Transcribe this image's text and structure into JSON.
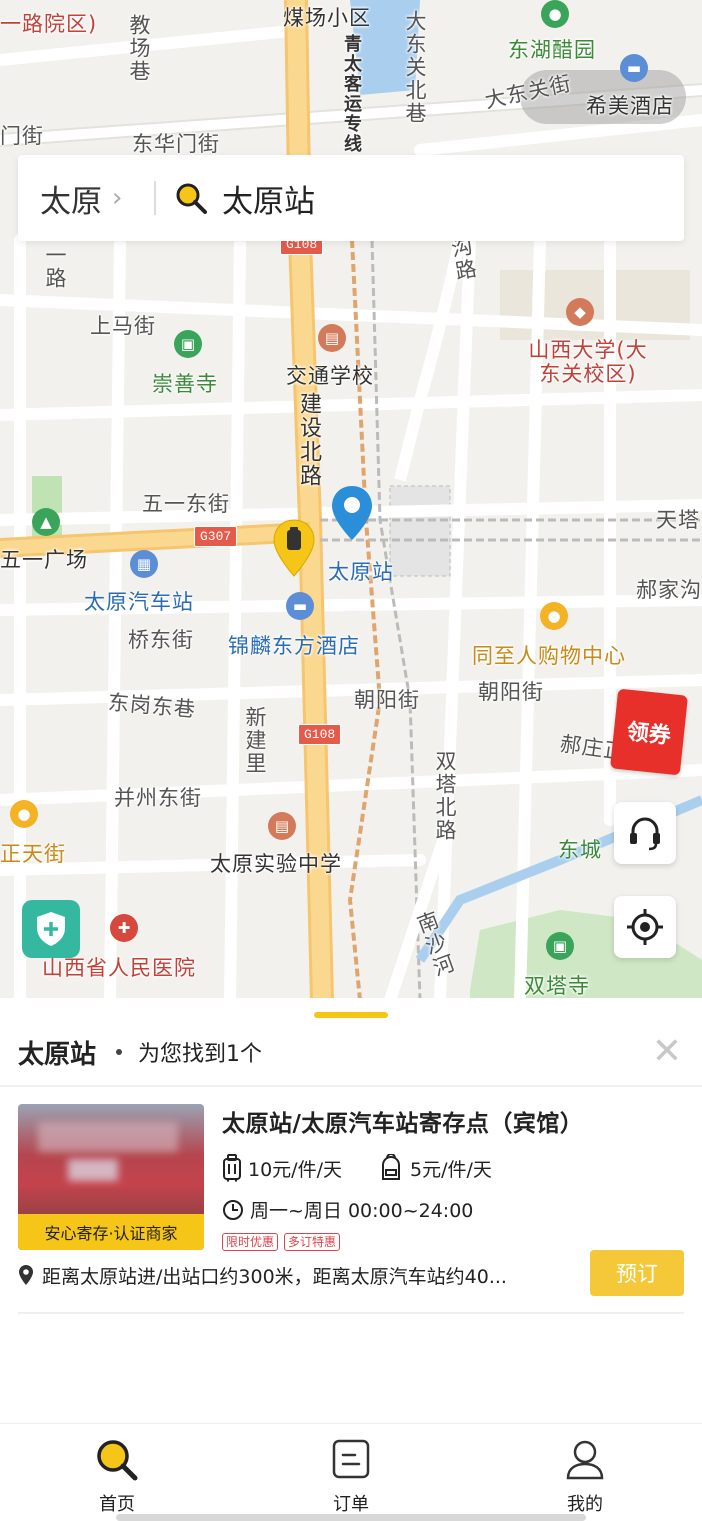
{
  "map": {
    "labels": {
      "meichang_xiaoqu": "煤场小区",
      "donghu_cuyuan": "东湖醋园",
      "dadongguan_jie": "大东关街",
      "ximei_jiudian": "希美酒店",
      "dongguan_beixiang": "大东关北巷",
      "jiaochang_xiang": "教场巷",
      "donghuamen_jie": "东华门街",
      "qingtai_keyun": "青太客运专线",
      "yilu_yuanqu": "一路院区)",
      "shangma_jie": "上马街",
      "chongshan_si": "崇善寺",
      "jiaotong_xuexiao": "交通学校",
      "shanxi_daxue": "山西大学(大东关校区)",
      "jianshe_beilu": "建设北路",
      "wuyi_dongjie": "五一东街",
      "wuyi_guangchang": "五一广场",
      "taiyuan_zhan": "太原站",
      "taiyuan_qichezhan": "太原汽车站",
      "tianta": "天塔",
      "qiaodong_jie": "桥东街",
      "jinlin_jiudian": "锦麟东方酒店",
      "tongzhiren": "同至人购物中心",
      "haojiagou": "郝家沟",
      "donggang_dongxiang": "东岗东巷",
      "chaoyang_jie": "朝阳街",
      "chaoyang_jie2": "朝阳街",
      "xinjianli": "新建里",
      "haozhuang": "郝庄正",
      "bingzhou_dongjie": "并州东街",
      "shuangta_beilu": "双塔北路",
      "zhengtian_jie": "正天街",
      "shiyan_zhongxue": "太原实验中学",
      "dongcheng": "东城",
      "renmin_yiyuan": "山西省人民医院",
      "nanshahe": "南沙河",
      "shuangta_si": "双塔寺",
      "goulu": "沟路",
      "yilu": "一路",
      "menjie": "门街"
    },
    "shields": {
      "g108_top": "G108",
      "g307": "G307",
      "g108_bottom": "G108"
    },
    "coupon_label": "领券"
  },
  "search": {
    "city": "太原",
    "query": "太原站"
  },
  "sheet": {
    "title": "太原站",
    "count_text": "为您找到1个",
    "close_icon": "close-icon",
    "store": {
      "name": "太原站/太原汽车站寄存点（宾馆）",
      "badge": "安心寄存·认证商家",
      "price_large": "10元/件/天",
      "price_small": "5元/件/天",
      "hours": "周一~周日 00:00~24:00",
      "tags": [
        "限时优惠",
        "多订特惠"
      ],
      "address": "距离太原站进/出站口约300米，距离太原汽车站约40...",
      "book_label": "预订"
    }
  },
  "nav": {
    "items": [
      {
        "label": "首页",
        "icon": "search-icon",
        "active": true
      },
      {
        "label": "订单",
        "icon": "order-icon",
        "active": false
      },
      {
        "label": "我的",
        "icon": "user-icon",
        "active": false
      }
    ]
  },
  "colors": {
    "accent": "#f5c518",
    "button": "#f5c83a",
    "tag_red": "#e0434a",
    "shield_green": "#35b8a0",
    "coupon_red": "#e8302a"
  }
}
